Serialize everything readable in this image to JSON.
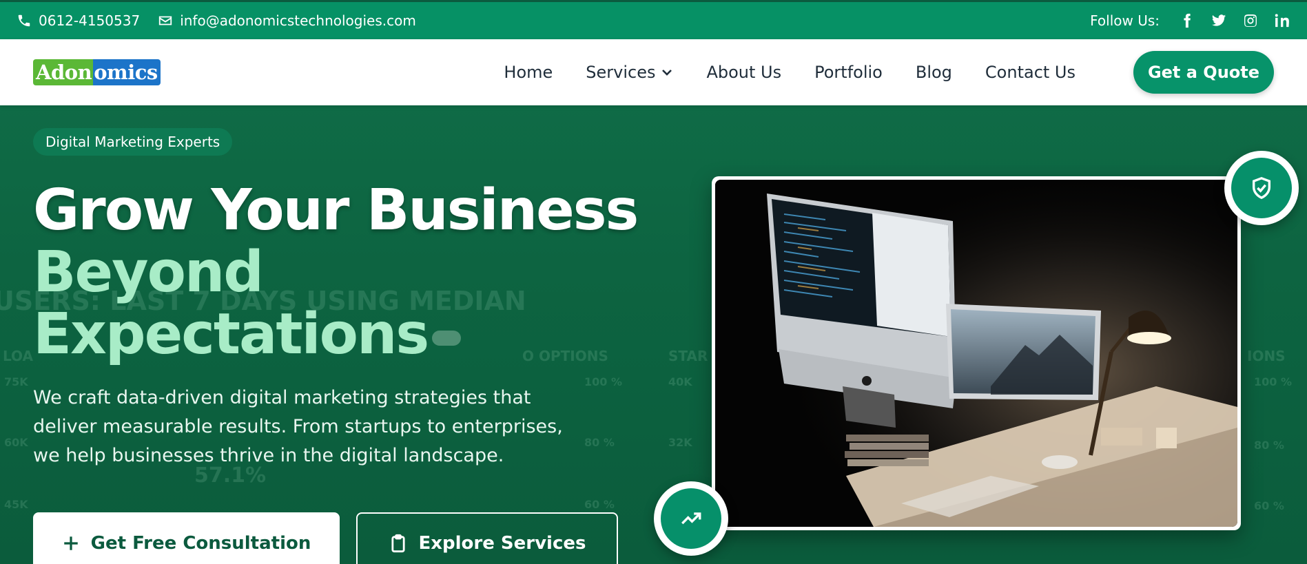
{
  "topbar": {
    "phone": "0612-4150537",
    "email": "info@adonomicstechnologies.com",
    "follow_label": "Follow Us:",
    "social_icons": [
      "facebook-icon",
      "twitter-icon",
      "instagram-icon",
      "linkedin-icon"
    ]
  },
  "brand": {
    "logo_part1": "Adon",
    "logo_part2": "omics",
    "colors": {
      "green": "#5bb836",
      "blue": "#1c74c9"
    }
  },
  "nav": {
    "items": [
      {
        "label": "Home"
      },
      {
        "label": "Services"
      },
      {
        "label": "About Us"
      },
      {
        "label": "Portfolio"
      },
      {
        "label": "Blog"
      },
      {
        "label": "Contact Us"
      }
    ],
    "cta": "Get a Quote"
  },
  "hero": {
    "badge": "Digital Marketing Experts",
    "title_line1": "Grow Your Business",
    "title_line2": "Beyond",
    "title_line3": "Expectations",
    "lead": "We craft data-driven digital marketing strategies that deliver measurable results. From startups to enterprises, we help businesses thrive in the digital landscape.",
    "primary_button": "Get Free Consultation",
    "secondary_button": "Explore Services",
    "background_overlay": {
      "heading": "USERS: LAST 7 DAYS USING MEDIAN",
      "options_label": "O OPTIONS",
      "star_label": "STAR",
      "ions_label": "IONS",
      "load_label": "LOA",
      "stat_value": "57.1%",
      "y_ticks_left": [
        "75K",
        "60K",
        "45K"
      ],
      "y_ticks_mid": [
        "100 %",
        "80 %",
        "60 %"
      ],
      "y_ticks_mid2": [
        "40K",
        "32K"
      ],
      "y_ticks_right": [
        "100 %",
        "80 %",
        "60 %"
      ]
    }
  },
  "theme": {
    "primary": "#07936a",
    "dark_green": "#0b5a3e",
    "accent_light": "#a8ecc7"
  }
}
